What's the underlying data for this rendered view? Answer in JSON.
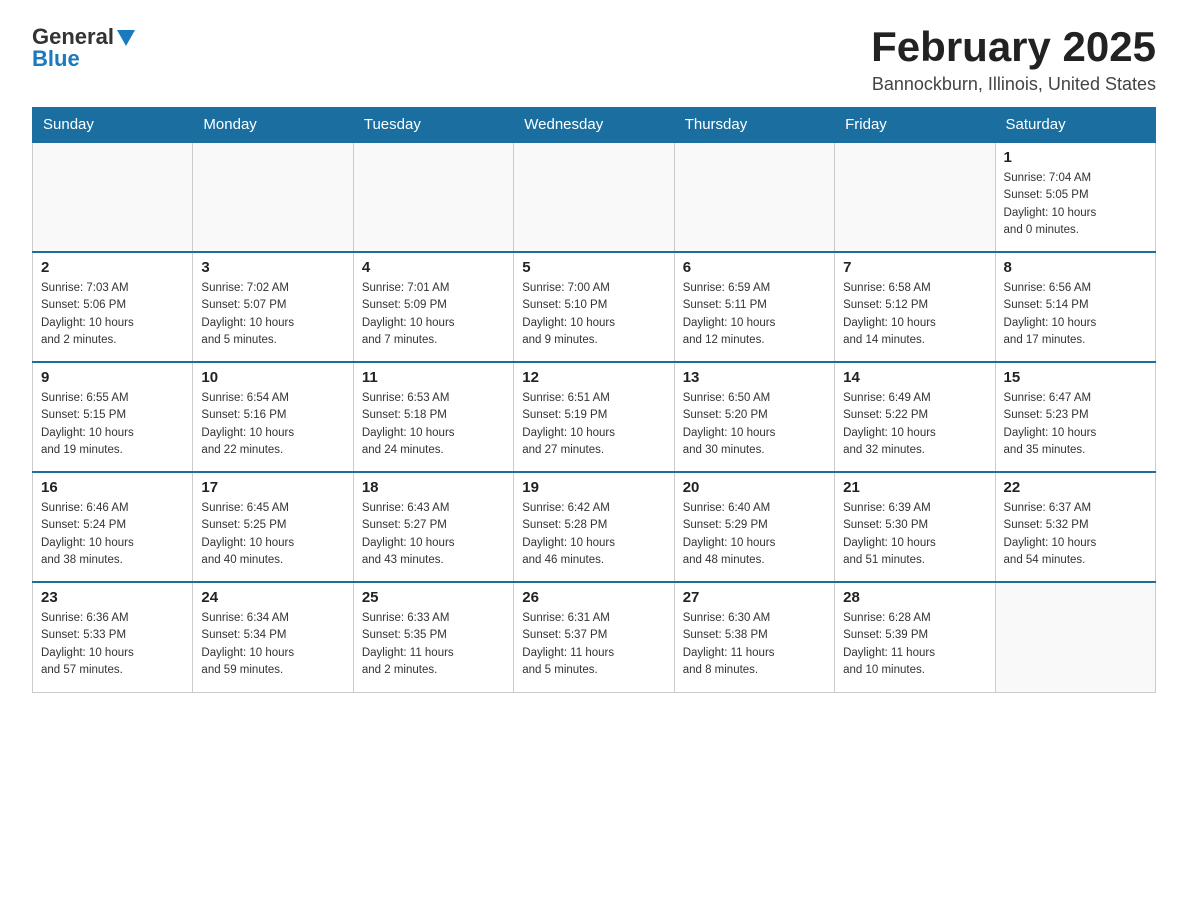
{
  "logo": {
    "general": "General",
    "blue": "Blue"
  },
  "header": {
    "month": "February 2025",
    "location": "Bannockburn, Illinois, United States"
  },
  "weekdays": [
    "Sunday",
    "Monday",
    "Tuesday",
    "Wednesday",
    "Thursday",
    "Friday",
    "Saturday"
  ],
  "weeks": [
    [
      {
        "day": "",
        "info": ""
      },
      {
        "day": "",
        "info": ""
      },
      {
        "day": "",
        "info": ""
      },
      {
        "day": "",
        "info": ""
      },
      {
        "day": "",
        "info": ""
      },
      {
        "day": "",
        "info": ""
      },
      {
        "day": "1",
        "info": "Sunrise: 7:04 AM\nSunset: 5:05 PM\nDaylight: 10 hours\nand 0 minutes."
      }
    ],
    [
      {
        "day": "2",
        "info": "Sunrise: 7:03 AM\nSunset: 5:06 PM\nDaylight: 10 hours\nand 2 minutes."
      },
      {
        "day": "3",
        "info": "Sunrise: 7:02 AM\nSunset: 5:07 PM\nDaylight: 10 hours\nand 5 minutes."
      },
      {
        "day": "4",
        "info": "Sunrise: 7:01 AM\nSunset: 5:09 PM\nDaylight: 10 hours\nand 7 minutes."
      },
      {
        "day": "5",
        "info": "Sunrise: 7:00 AM\nSunset: 5:10 PM\nDaylight: 10 hours\nand 9 minutes."
      },
      {
        "day": "6",
        "info": "Sunrise: 6:59 AM\nSunset: 5:11 PM\nDaylight: 10 hours\nand 12 minutes."
      },
      {
        "day": "7",
        "info": "Sunrise: 6:58 AM\nSunset: 5:12 PM\nDaylight: 10 hours\nand 14 minutes."
      },
      {
        "day": "8",
        "info": "Sunrise: 6:56 AM\nSunset: 5:14 PM\nDaylight: 10 hours\nand 17 minutes."
      }
    ],
    [
      {
        "day": "9",
        "info": "Sunrise: 6:55 AM\nSunset: 5:15 PM\nDaylight: 10 hours\nand 19 minutes."
      },
      {
        "day": "10",
        "info": "Sunrise: 6:54 AM\nSunset: 5:16 PM\nDaylight: 10 hours\nand 22 minutes."
      },
      {
        "day": "11",
        "info": "Sunrise: 6:53 AM\nSunset: 5:18 PM\nDaylight: 10 hours\nand 24 minutes."
      },
      {
        "day": "12",
        "info": "Sunrise: 6:51 AM\nSunset: 5:19 PM\nDaylight: 10 hours\nand 27 minutes."
      },
      {
        "day": "13",
        "info": "Sunrise: 6:50 AM\nSunset: 5:20 PM\nDaylight: 10 hours\nand 30 minutes."
      },
      {
        "day": "14",
        "info": "Sunrise: 6:49 AM\nSunset: 5:22 PM\nDaylight: 10 hours\nand 32 minutes."
      },
      {
        "day": "15",
        "info": "Sunrise: 6:47 AM\nSunset: 5:23 PM\nDaylight: 10 hours\nand 35 minutes."
      }
    ],
    [
      {
        "day": "16",
        "info": "Sunrise: 6:46 AM\nSunset: 5:24 PM\nDaylight: 10 hours\nand 38 minutes."
      },
      {
        "day": "17",
        "info": "Sunrise: 6:45 AM\nSunset: 5:25 PM\nDaylight: 10 hours\nand 40 minutes."
      },
      {
        "day": "18",
        "info": "Sunrise: 6:43 AM\nSunset: 5:27 PM\nDaylight: 10 hours\nand 43 minutes."
      },
      {
        "day": "19",
        "info": "Sunrise: 6:42 AM\nSunset: 5:28 PM\nDaylight: 10 hours\nand 46 minutes."
      },
      {
        "day": "20",
        "info": "Sunrise: 6:40 AM\nSunset: 5:29 PM\nDaylight: 10 hours\nand 48 minutes."
      },
      {
        "day": "21",
        "info": "Sunrise: 6:39 AM\nSunset: 5:30 PM\nDaylight: 10 hours\nand 51 minutes."
      },
      {
        "day": "22",
        "info": "Sunrise: 6:37 AM\nSunset: 5:32 PM\nDaylight: 10 hours\nand 54 minutes."
      }
    ],
    [
      {
        "day": "23",
        "info": "Sunrise: 6:36 AM\nSunset: 5:33 PM\nDaylight: 10 hours\nand 57 minutes."
      },
      {
        "day": "24",
        "info": "Sunrise: 6:34 AM\nSunset: 5:34 PM\nDaylight: 10 hours\nand 59 minutes."
      },
      {
        "day": "25",
        "info": "Sunrise: 6:33 AM\nSunset: 5:35 PM\nDaylight: 11 hours\nand 2 minutes."
      },
      {
        "day": "26",
        "info": "Sunrise: 6:31 AM\nSunset: 5:37 PM\nDaylight: 11 hours\nand 5 minutes."
      },
      {
        "day": "27",
        "info": "Sunrise: 6:30 AM\nSunset: 5:38 PM\nDaylight: 11 hours\nand 8 minutes."
      },
      {
        "day": "28",
        "info": "Sunrise: 6:28 AM\nSunset: 5:39 PM\nDaylight: 11 hours\nand 10 minutes."
      },
      {
        "day": "",
        "info": ""
      }
    ]
  ]
}
